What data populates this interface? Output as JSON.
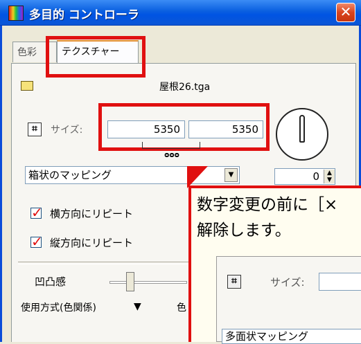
{
  "window": {
    "title": "多目的 コントローラ",
    "close_glyph": "✕"
  },
  "tabs": [
    {
      "label": "色彩"
    },
    {
      "label": "テクスチャー"
    }
  ],
  "texture": {
    "file_name": "屋根26.tga",
    "size_label": "サイズ:",
    "width": "5350",
    "height": "5350",
    "link_glyph": "ᴑᴑᴑ",
    "mapping": "箱状のマッピング",
    "angle": "0",
    "repeat_horizontal": {
      "label": "横方向にリピート",
      "checked": true
    },
    "repeat_vertical": {
      "label": "縦方向にリピート",
      "checked": true
    },
    "bump_label": "凹凸感",
    "usage_label": "使用方式(色関係)",
    "usage_value": "色"
  },
  "callout": {
    "text": "数字変更の前に［×\n解除します。",
    "inner_size_label": "サイズ:",
    "inner_mapping": "多面状マッピング"
  },
  "colors": {
    "highlight": "#e01010",
    "titlebar": "#0054e3"
  }
}
